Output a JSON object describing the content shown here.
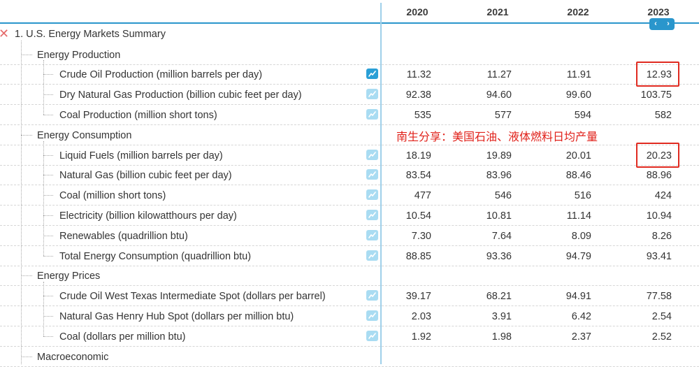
{
  "header": {
    "years": [
      "2020",
      "2021",
      "2022",
      "2023"
    ]
  },
  "nav": {
    "prev": "‹",
    "next": "›"
  },
  "close_glyph": "✕",
  "section_title": "1. U.S. Energy Markets Summary",
  "annotation": "南生分享：美国石油、液体燃料日均产量",
  "groups": [
    {
      "title": "Energy Production",
      "rows": [
        {
          "label": "Crude Oil Production (million barrels per day)",
          "values": [
            "11.32",
            "11.27",
            "11.91",
            "12.93"
          ],
          "highlight_last": true,
          "active_chart": true
        },
        {
          "label": "Dry Natural Gas Production (billion cubic feet per day)",
          "values": [
            "92.38",
            "94.60",
            "99.60",
            "103.75"
          ]
        },
        {
          "label": "Coal Production (million short tons)",
          "values": [
            "535",
            "577",
            "594",
            "582"
          ]
        }
      ]
    },
    {
      "title": "Energy Consumption",
      "rows": [
        {
          "label": "Liquid Fuels (million barrels per day)",
          "values": [
            "18.19",
            "19.89",
            "20.01",
            "20.23"
          ],
          "highlight_last": true
        },
        {
          "label": "Natural Gas (billion cubic feet per day)",
          "values": [
            "83.54",
            "83.96",
            "88.46",
            "88.96"
          ]
        },
        {
          "label": "Coal (million short tons)",
          "values": [
            "477",
            "546",
            "516",
            "424"
          ]
        },
        {
          "label": "Electricity (billion kilowatthours per day)",
          "values": [
            "10.54",
            "10.81",
            "11.14",
            "10.94"
          ]
        },
        {
          "label": "Renewables (quadrillion btu)",
          "values": [
            "7.30",
            "7.64",
            "8.09",
            "8.26"
          ]
        },
        {
          "label": "Total Energy Consumption (quadrillion btu)",
          "values": [
            "88.85",
            "93.36",
            "94.79",
            "93.41"
          ]
        }
      ]
    },
    {
      "title": "Energy Prices",
      "rows": [
        {
          "label": "Crude Oil West Texas Intermediate Spot (dollars per barrel)",
          "values": [
            "39.17",
            "68.21",
            "94.91",
            "77.58"
          ]
        },
        {
          "label": "Natural Gas Henry Hub Spot (dollars per million btu)",
          "values": [
            "2.03",
            "3.91",
            "6.42",
            "2.54"
          ]
        },
        {
          "label": "Coal (dollars per million btu)",
          "values": [
            "1.92",
            "1.98",
            "2.37",
            "2.52"
          ]
        }
      ]
    },
    {
      "title": "Macroeconomic",
      "rows": []
    }
  ]
}
